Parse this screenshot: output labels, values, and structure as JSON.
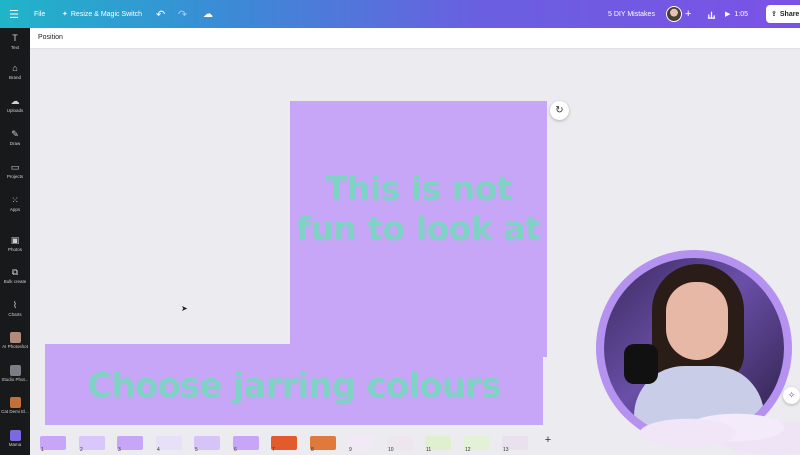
{
  "topbar": {
    "menu_icon": "menu-icon",
    "file_label": "File",
    "resize_label": "Resize & Magic Switch",
    "design_title": "5 DIY Mistakes",
    "timer": "1:05",
    "share_label": "Share"
  },
  "sidebar": {
    "items": [
      {
        "label": "Text",
        "icon": "text-icon"
      },
      {
        "label": "Brand",
        "icon": "brand-icon"
      },
      {
        "label": "Uploads",
        "icon": "upload-icon"
      },
      {
        "label": "Draw",
        "icon": "draw-icon"
      },
      {
        "label": "Projects",
        "icon": "folder-icon"
      },
      {
        "label": "Apps",
        "icon": "apps-icon"
      },
      {
        "label": "Photos",
        "icon": "photos-icon"
      },
      {
        "label": "Bulk create",
        "icon": "bulk-create-icon"
      },
      {
        "label": "Charts",
        "icon": "charts-icon"
      },
      {
        "label": "AI Photoshot",
        "icon": "app-thumb"
      },
      {
        "label": "Studio Phot...",
        "icon": "app-thumb"
      },
      {
        "label": "Cat Demi El...",
        "icon": "app-thumb"
      },
      {
        "label": "Mama",
        "icon": "app-thumb"
      }
    ]
  },
  "context_toolbar": {
    "position_label": "Position"
  },
  "canvas": {
    "page_text": "This is not fun to look at",
    "banner_text": "Choose jarring colours",
    "colors": {
      "fill": "#c8a6f7",
      "text": "#7fd3c5"
    }
  },
  "pages": {
    "numbers": [
      "1",
      "2",
      "3",
      "4",
      "5",
      "6",
      "7",
      "8",
      "9",
      "10",
      "11",
      "12",
      "13"
    ]
  }
}
